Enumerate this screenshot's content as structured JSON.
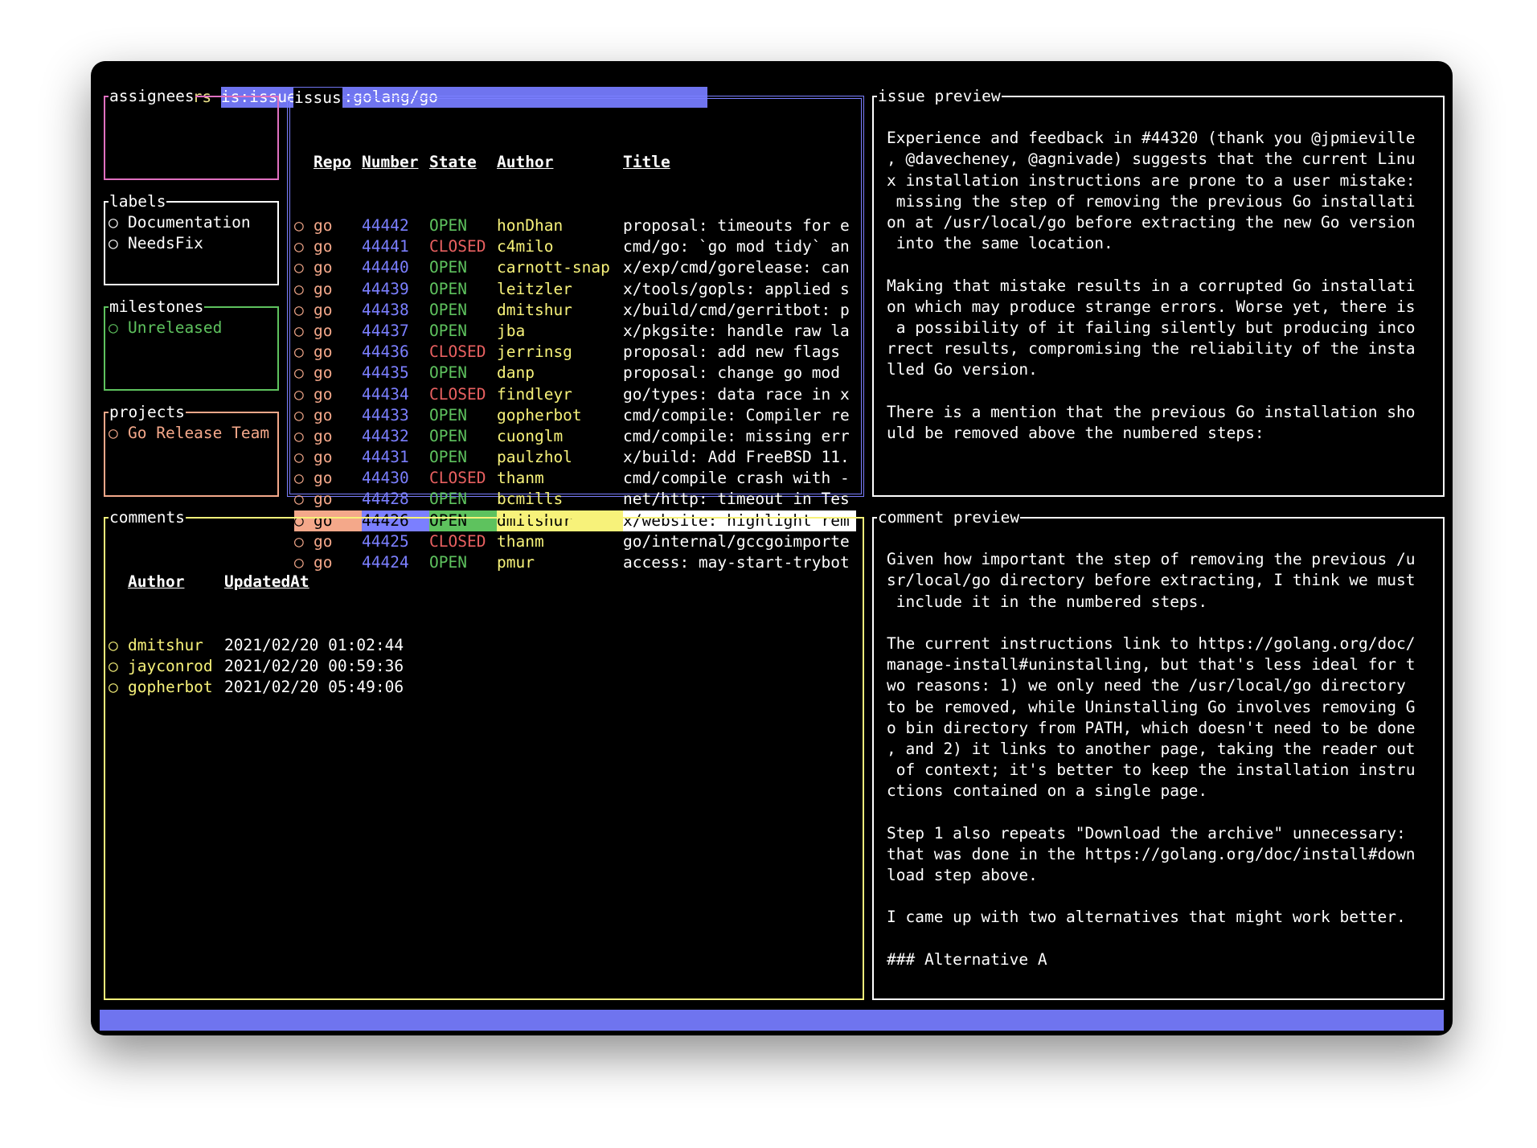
{
  "filter": {
    "label": "Filters",
    "value": "is:issue repo:golang/go"
  },
  "colors": {
    "filter_bg": "#6f74ef",
    "assignees_border": "#e070c0",
    "labels_border": "#ffffff",
    "milestones_border": "#5ec25e",
    "projects_border": "#f4a88a",
    "issues_border": "#7b7fff",
    "comments_border": "#f7f27a",
    "preview_border": "#ffffff"
  },
  "assignees": {
    "title": "assignees",
    "items": []
  },
  "labels": {
    "title": "labels",
    "items": [
      "Documentation",
      "NeedsFix"
    ]
  },
  "milestones": {
    "title": "milestones",
    "items": [
      "Unreleased"
    ]
  },
  "projects": {
    "title": "projects",
    "items": [
      "Go Release Team"
    ]
  },
  "issues": {
    "title": "issus",
    "headers": {
      "repo": "Repo",
      "number": "Number",
      "state": "State",
      "author": "Author",
      "title": "Title"
    },
    "selected_index": 14,
    "rows": [
      {
        "repo": "go",
        "number": "44442",
        "state": "OPEN",
        "author": "honDhan",
        "title": "proposal: timeouts for e"
      },
      {
        "repo": "go",
        "number": "44441",
        "state": "CLOSED",
        "author": "c4milo",
        "title": "cmd/go: `go mod tidy` an"
      },
      {
        "repo": "go",
        "number": "44440",
        "state": "OPEN",
        "author": "carnott-snap",
        "title": "x/exp/cmd/gorelease: can"
      },
      {
        "repo": "go",
        "number": "44439",
        "state": "OPEN",
        "author": "leitzler",
        "title": "x/tools/gopls: applied s"
      },
      {
        "repo": "go",
        "number": "44438",
        "state": "OPEN",
        "author": "dmitshur",
        "title": "x/build/cmd/gerritbot: p"
      },
      {
        "repo": "go",
        "number": "44437",
        "state": "OPEN",
        "author": "jba",
        "title": "x/pkgsite: handle raw la"
      },
      {
        "repo": "go",
        "number": "44436",
        "state": "CLOSED",
        "author": "jerrinsg",
        "title": "proposal: add new flags"
      },
      {
        "repo": "go",
        "number": "44435",
        "state": "OPEN",
        "author": "danp",
        "title": "proposal: change go mod"
      },
      {
        "repo": "go",
        "number": "44434",
        "state": "CLOSED",
        "author": "findleyr",
        "title": "go/types: data race in x"
      },
      {
        "repo": "go",
        "number": "44433",
        "state": "OPEN",
        "author": "gopherbot",
        "title": "cmd/compile: Compiler re"
      },
      {
        "repo": "go",
        "number": "44432",
        "state": "OPEN",
        "author": "cuonglm",
        "title": "cmd/compile: missing err"
      },
      {
        "repo": "go",
        "number": "44431",
        "state": "OPEN",
        "author": "paulzhol",
        "title": "x/build: Add FreeBSD 11."
      },
      {
        "repo": "go",
        "number": "44430",
        "state": "CLOSED",
        "author": "thanm",
        "title": "cmd/compile crash with -"
      },
      {
        "repo": "go",
        "number": "44428",
        "state": "OPEN",
        "author": "bcmills",
        "title": "net/http: timeout in Tes"
      },
      {
        "repo": "go",
        "number": "44426",
        "state": "OPEN",
        "author": "dmitshur",
        "title": "x/website: highlight rem"
      },
      {
        "repo": "go",
        "number": "44425",
        "state": "CLOSED",
        "author": "thanm",
        "title": "go/internal/gccgoimporte"
      },
      {
        "repo": "go",
        "number": "44424",
        "state": "OPEN",
        "author": "pmur",
        "title": "access: may-start-trybot"
      }
    ]
  },
  "issue_preview": {
    "title": "issue preview",
    "lines": [
      "",
      "Experience and feedback in #44320 (thank you @jpmieville",
      ", @davecheney, @agnivade) suggests that the current Linu",
      "x installation instructions are prone to a user mistake:",
      " missing the step of removing the previous Go installati",
      "on at /usr/local/go before extracting the new Go version",
      " into the same location.",
      "",
      "Making that mistake results in a corrupted Go installati",
      "on which may produce strange errors. Worse yet, there is",
      " a possibility of it failing silently but producing inco",
      "rrect results, compromising the reliability of the insta",
      "lled Go version.",
      "",
      "There is a mention that the previous Go installation sho",
      "uld be removed above the numbered steps:"
    ]
  },
  "comments": {
    "title": "comments",
    "headers": {
      "author": "Author",
      "updated": "UpdatedAt"
    },
    "rows": [
      {
        "author": "dmitshur",
        "updated": "2021/02/20 01:02:44"
      },
      {
        "author": "jayconrod",
        "updated": "2021/02/20 00:59:36"
      },
      {
        "author": "gopherbot",
        "updated": "2021/02/20 05:49:06"
      }
    ]
  },
  "comment_preview": {
    "title": "comment preview",
    "lines": [
      "",
      "Given how important the step of removing the previous /u",
      "sr/local/go directory before extracting, I think we must",
      " include it in the numbered steps.",
      "",
      "The current instructions link to https://golang.org/doc/",
      "manage-install#uninstalling, but that's less ideal for t",
      "wo reasons: 1) we only need the /usr/local/go directory",
      "to be removed, while Uninstalling Go involves removing G",
      "o bin directory from PATH, which doesn't need to be done",
      ", and 2) it links to another page, taking the reader out",
      " of context; it's better to keep the installation instru",
      "ctions contained on a single page.",
      "",
      "Step 1 also repeats \"Download the archive\" unnecessary:",
      "that was done in the https://golang.org/doc/install#down",
      "load step above.",
      "",
      "I came up with two alternatives that might work better.",
      "",
      "### Alternative A"
    ]
  },
  "bullet_glyph": "○"
}
